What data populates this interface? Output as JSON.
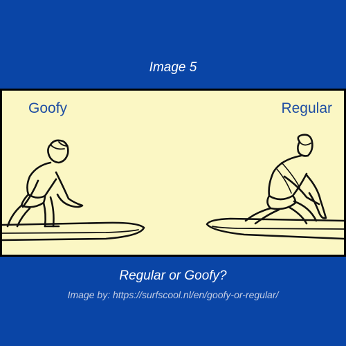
{
  "colors": {
    "background": "#0a45a6",
    "panel": "#fbf7c4",
    "label_text": "#1f4ea3",
    "ink": "#111111"
  },
  "image_number": "Image 5",
  "figure": {
    "left_label": "Goofy",
    "right_label": "Regular"
  },
  "caption": "Regular or Goofy?",
  "credit": "Image by: https://surfscool.nl/en/goofy-or-regular/"
}
